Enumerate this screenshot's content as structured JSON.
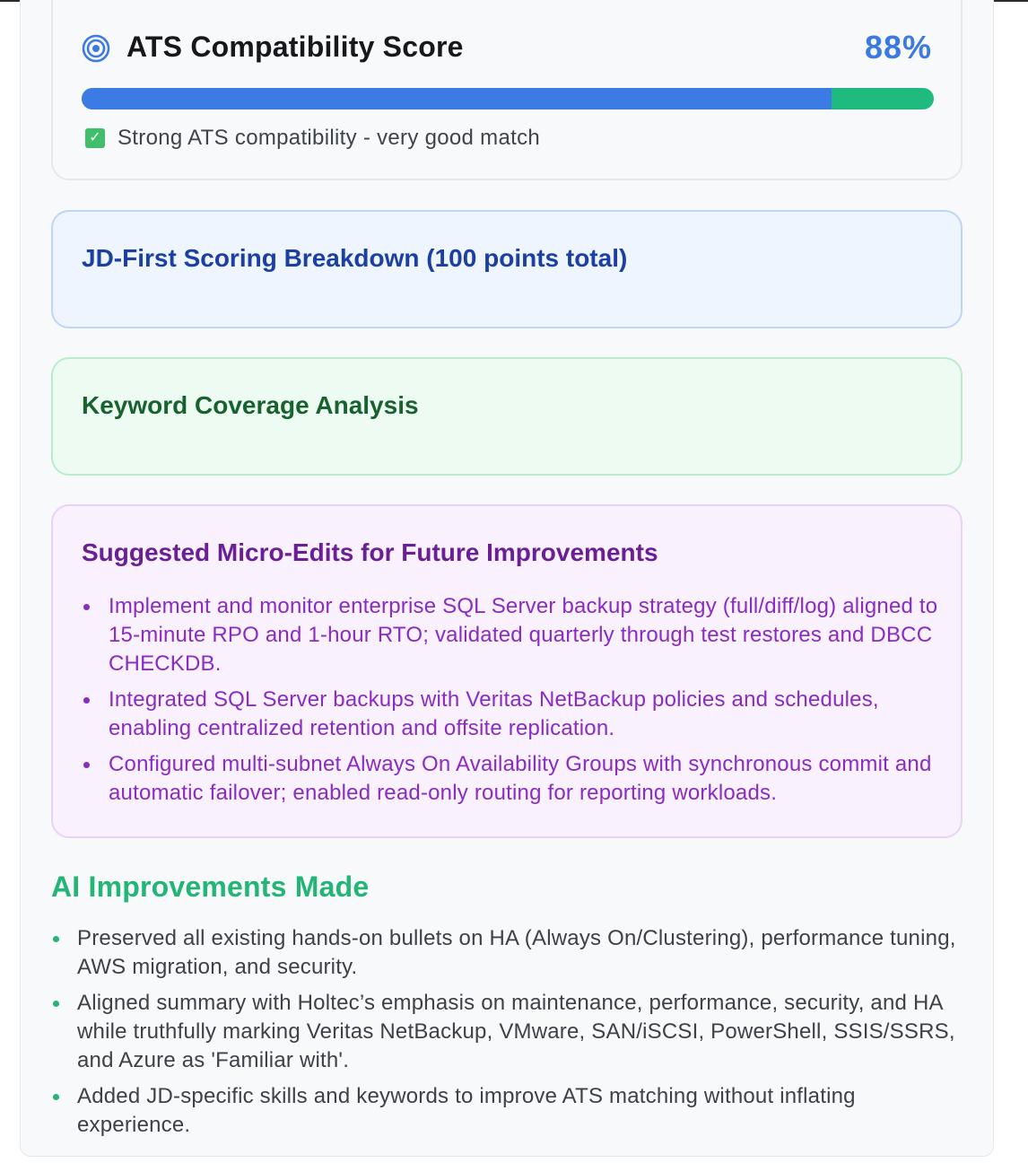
{
  "ats": {
    "title": "ATS Compatibility Score",
    "score_text": "88%",
    "score_fraction": 0.88,
    "status_icon": "check-mark-button-icon",
    "status_text": "Strong ATS compatibility - very good match",
    "colors": {
      "bar_fill": "#3b7be3",
      "bar_track": "#1fba7e",
      "score": "#3b7ae0"
    }
  },
  "jd_breakdown": {
    "title": "JD-First Scoring Breakdown (100 points total)"
  },
  "keyword_coverage": {
    "title": "Keyword Coverage Analysis"
  },
  "micro_edits": {
    "title": "Suggested Micro-Edits for Future Improvements",
    "items": [
      "Implement and monitor enterprise SQL Server backup strategy (full/diff/log) aligned to 15-minute RPO and 1-hour RTO; validated quarterly through test restores and DBCC CHECKDB.",
      "Integrated SQL Server backups with Veritas NetBackup policies and schedules, enabling centralized retention and offsite replication.",
      "Configured multi-subnet Always On Availability Groups with synchronous commit and automatic failover; enabled read-only routing for reporting workloads."
    ]
  },
  "ai_improvements": {
    "title": "AI Improvements Made",
    "items": [
      "Preserved all existing hands-on bullets on HA (Always On/Clustering), performance tuning, AWS migration, and security.",
      "Aligned summary with Holtec’s emphasis on maintenance, performance, security, and HA while truthfully marking Veritas NetBackup, VMware, SAN/iSCSI, PowerShell, SSIS/SSRS, and Azure as 'Familiar with'.",
      "Added JD-specific skills and keywords to improve ATS matching without inflating experience."
    ]
  }
}
